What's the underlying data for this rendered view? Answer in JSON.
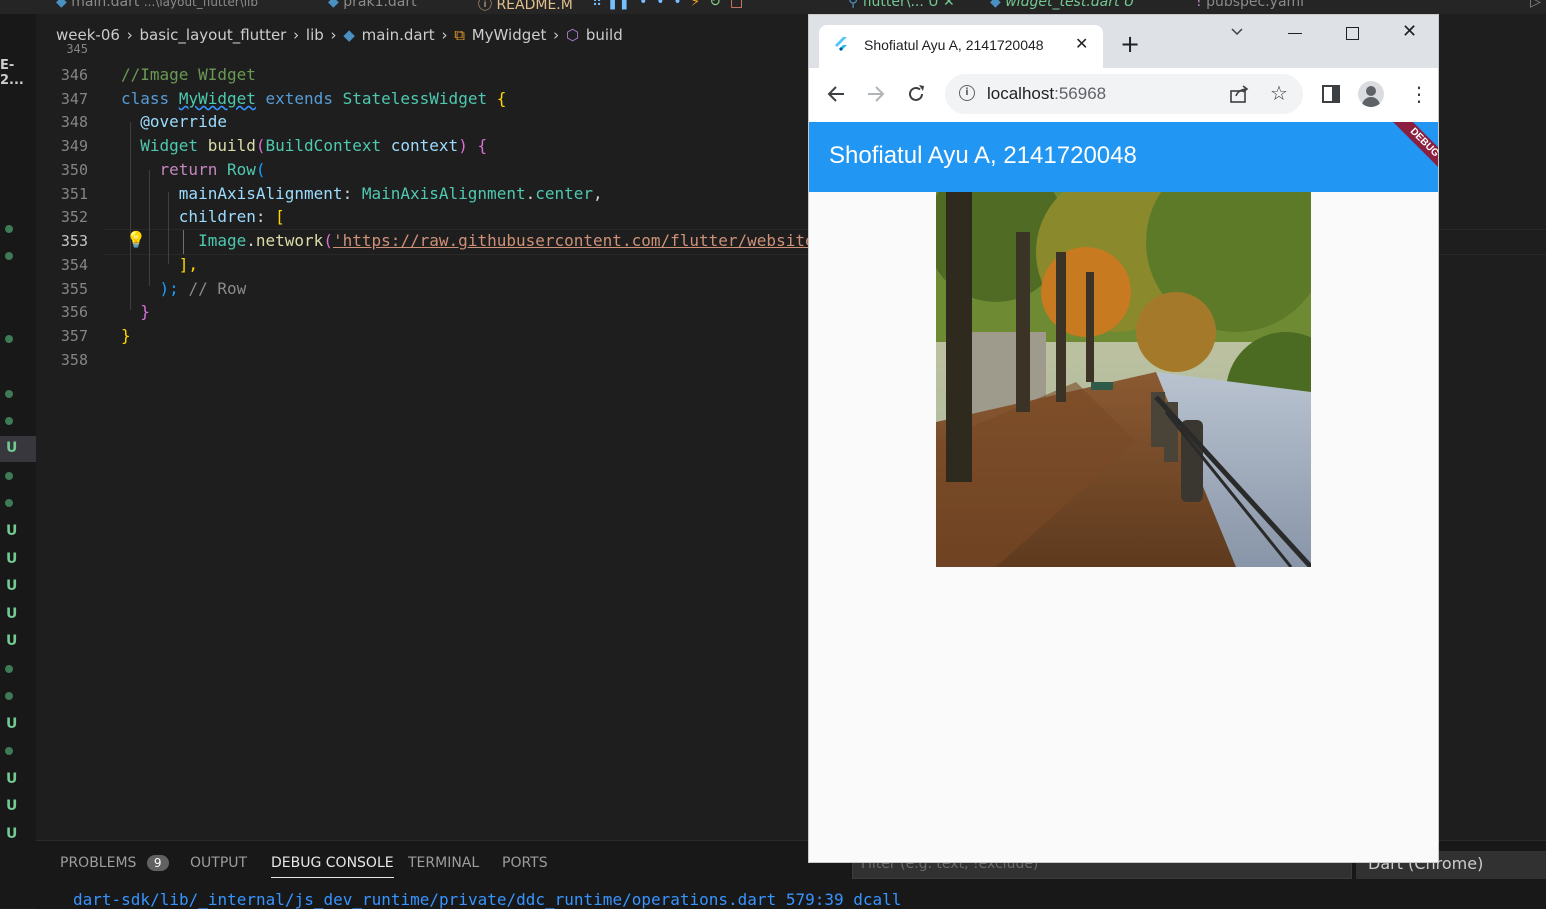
{
  "editor_tabs": [
    {
      "label": "main.dart",
      "detail": "...\\layout_flutter\\lib"
    },
    {
      "label": "prak1.dart"
    },
    {
      "label": "README.M"
    },
    {
      "label": "flutter\\... U"
    },
    {
      "label": "widget_test.dart U"
    },
    {
      "label": "pubspec.yaml"
    }
  ],
  "sidebar_label": "E-2...",
  "scm_marks": [
    "U",
    "U",
    "U",
    "U",
    "U",
    "U",
    "U",
    "U",
    "U",
    "U"
  ],
  "breadcrumb": [
    "week-06",
    "basic_layout_flutter",
    "lib",
    "main.dart",
    "MyWidget",
    "build"
  ],
  "code": {
    "line_numbers": [
      "345",
      "346",
      "347",
      "348",
      "349",
      "350",
      "351",
      "352",
      "353",
      "354",
      "355",
      "356",
      "357",
      "358"
    ],
    "l346": "//Image WIdget",
    "class_kw": "class",
    "class_name": "MyWidget",
    "extends_kw": "extends",
    "super_name": "StatelessWidget",
    "open_brace": "{",
    "override": "@override",
    "widget_type": "Widget",
    "build_fn": "build",
    "ctx_type": "BuildContext",
    "ctx_name": "context",
    "return_kw": "return",
    "row": "Row",
    "main_axis": "mainAxisAlignment",
    "main_axis_type": "MainAxisAlignment",
    "main_axis_value": "center",
    "children": "children",
    "image_cls": "Image",
    "network_fn": "network",
    "url": "'https://raw.githubusercontent.com/flutter/website",
    "close_list": "],",
    "close_row": ");",
    "row_hint": "// Row",
    "close_method": "}",
    "close_class": "}"
  },
  "panel": {
    "tabs": [
      "PROBLEMS",
      "OUTPUT",
      "DEBUG CONSOLE",
      "TERMINAL",
      "PORTS"
    ],
    "problems_count": "9",
    "active": "DEBUG CONSOLE",
    "filter_placeholder": "Filter (e.g. text, !exclude)",
    "debug_target": "Dart (Chrome)",
    "console_line": "dart-sdk/lib/_internal/js_dev_runtime/private/ddc_runtime/operations.dart 579:39   dcall"
  },
  "browser": {
    "tab_title": "Shofiatul Ayu A, 2141720048",
    "url_host": "localhost",
    "url_port": ":56968",
    "appbar_title": "Shofiatul Ayu A, 2141720048",
    "debug_banner": "DEBUG",
    "theme_color": "#2196f3"
  }
}
